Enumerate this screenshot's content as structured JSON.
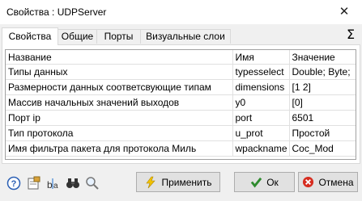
{
  "window": {
    "title": "Свойства : UDPServer",
    "close_glyph": "✕"
  },
  "tabs": [
    {
      "label": "Свойства"
    },
    {
      "label": "Общие"
    },
    {
      "label": "Порты"
    },
    {
      "label": "Визуальные слои"
    }
  ],
  "sigma_glyph": "Σ",
  "table": {
    "headers": [
      "Название",
      "Имя",
      "Значение"
    ],
    "rows": [
      [
        "Типы данных",
        "typesselect",
        "Double; Byte;"
      ],
      [
        "Размерности данных соответсвующие типам",
        "dimensions",
        "[1 2]"
      ],
      [
        "Массив начальных значений выходов",
        "y0",
        "[0]"
      ],
      [
        "Порт ip",
        "port",
        "6501"
      ],
      [
        "Тип протокола",
        "u_prot",
        "Простой"
      ],
      [
        "Имя фильтра пакета для протокола Миль",
        "wpackname",
        "Coc_Mod"
      ]
    ]
  },
  "buttons": {
    "apply": "Применить",
    "ok": "Ок",
    "cancel": "Отмена"
  },
  "icons": [
    "help-icon",
    "properties-icon",
    "rename-icon",
    "binoculars-icon",
    "search-icon"
  ]
}
